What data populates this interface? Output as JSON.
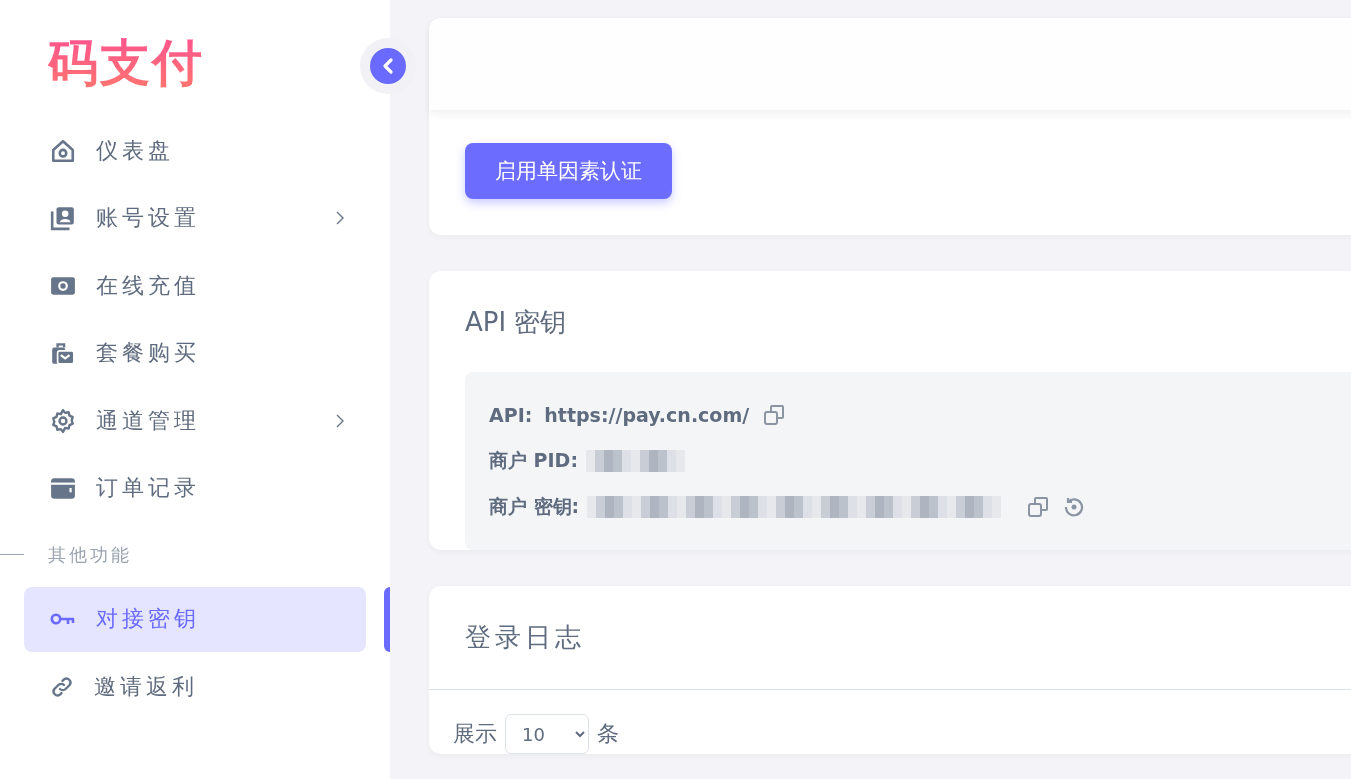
{
  "logo": "码支付",
  "sidebar": {
    "items": [
      {
        "label": "仪表盘",
        "submenu": false,
        "selected": false
      },
      {
        "label": "账号设置",
        "submenu": true,
        "selected": false
      },
      {
        "label": "在线充值",
        "submenu": false,
        "selected": false
      },
      {
        "label": "套餐购买",
        "submenu": false,
        "selected": false
      },
      {
        "label": "通道管理",
        "submenu": true,
        "selected": false
      },
      {
        "label": "订单记录",
        "submenu": false,
        "selected": false
      }
    ],
    "section_label": "其他功能",
    "other_items": [
      {
        "label": "对接密钥",
        "submenu": false,
        "selected": true
      },
      {
        "label": "邀请返利",
        "submenu": false,
        "selected": false
      }
    ]
  },
  "security_card": {
    "button": "启用单因素认证"
  },
  "api_card": {
    "title": "API 密钥",
    "rows": [
      {
        "label": "API:",
        "kind": "text",
        "value": "https://pay.cn.com/",
        "copyable": true,
        "resettable": false
      },
      {
        "label": "商户 PID:",
        "kind": "redacted",
        "copyable": false,
        "resettable": false
      },
      {
        "label": "商户 密钥:",
        "kind": "redacted",
        "copyable": true,
        "resettable": true
      }
    ]
  },
  "log_card": {
    "title": "登录日志",
    "show_prefix": "展示",
    "page_size": "10",
    "show_suffix": "条"
  }
}
